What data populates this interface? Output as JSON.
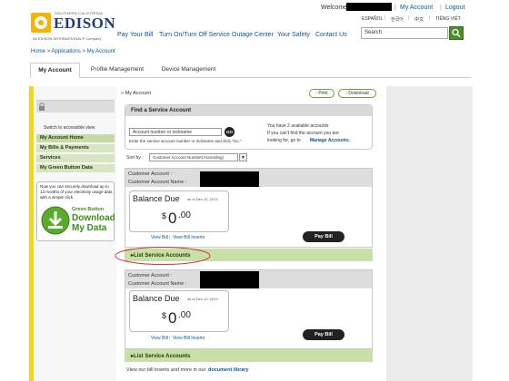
{
  "header": {
    "logo_top": "SOUTHERN CALIFORNIA",
    "logo_main": "EDISON",
    "logo_sub": "An EDISON INTERNATIONAL® Company",
    "welcome": "Welcome",
    "my_account": "My Account",
    "logout": "Logout",
    "languages": [
      "ESPAÑOL",
      "한국어",
      "中文",
      "TIẾNG VIỆT"
    ],
    "search_placeholder": "Search",
    "nav": [
      "Pay Your Bill",
      "Turn On/Turn Off Service",
      "Outage Center",
      "Your Safety",
      "Contact Us"
    ]
  },
  "breadcrumb": "Home > Applications > My Account",
  "tabs": [
    "My Account",
    "Profile Management",
    "Device Management"
  ],
  "sidebar": {
    "accessible": "Switch to accessible view",
    "items": [
      "My Account Home",
      "My Bills & Payments",
      "Services",
      "My Green Button Data"
    ],
    "promo_text": "Now you can securely download up to 13 months of your electricity usage data with a simple click.",
    "green_button_l1": "Green Button",
    "green_button_l2": "Download",
    "green_button_l3": "My Data"
  },
  "content": {
    "crumb": "» My Account",
    "print": "Print",
    "download": "Download",
    "find_title": "Find a Service Account",
    "input_value": "Account number or nickname",
    "go": "GO",
    "hint": "Enter the service account number or nickname and click \"Go.\"",
    "available_l1": "You have 2 available accounts",
    "available_l2": "If you can't find the account you are",
    "available_l3": "looking for, go to",
    "manage_link": "Manage Accounts.",
    "sort_label": "Sort by :",
    "sort_value": "Customer Account Number(Ascending)",
    "accounts": [
      {
        "cust_acct": "Customer Account :",
        "cust_name": "Customer Account Name :",
        "balance_label": "Balance Due",
        "as_of": "as of Dec 10, 2013",
        "amount_dollar": "$",
        "amount_int": "0",
        "amount_dec": ".00",
        "view_bill": "View Bill",
        "view_inserts": "View Bill Inserts",
        "pay": "Pay Bill",
        "list_label": "List Service Accounts"
      },
      {
        "cust_acct": "Customer Account :",
        "cust_name": "Customer Account Name :",
        "balance_label": "Balance Due",
        "as_of": "as of Dec 10, 2013",
        "amount_dollar": "$",
        "amount_int": "0",
        "amount_dec": ".00",
        "view_bill": "View Bill",
        "view_inserts": "View Bill Inserts",
        "pay": "Pay Bill",
        "list_label": "List Service Accounts"
      }
    ],
    "footer_text": "View our bill inserts and more in our",
    "footer_link": "document library"
  },
  "colors": {
    "brand_blue": "#1f3f73",
    "link_blue": "#0a57a6",
    "green_strip": "#c9dfa8",
    "yellow_accent": "#f6d418"
  }
}
